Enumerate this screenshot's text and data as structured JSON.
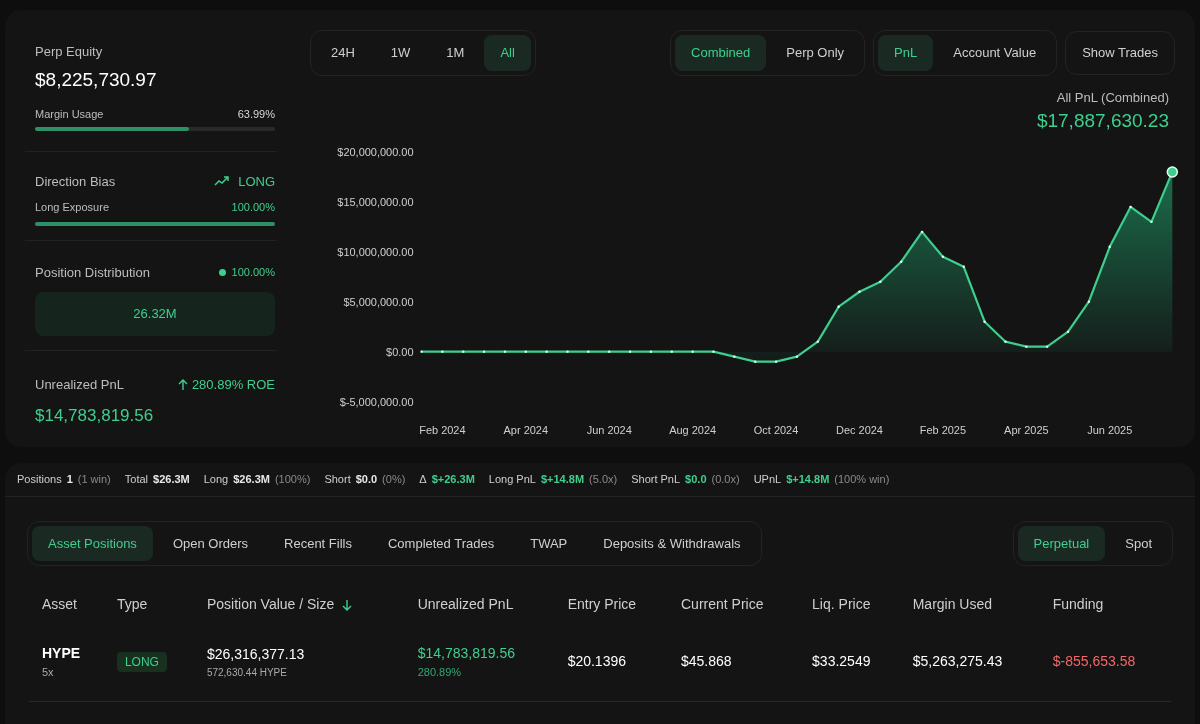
{
  "summary": {
    "equity": {
      "label": "Perp Equity",
      "value": "$8,225,730.97"
    },
    "margin": {
      "label": "Margin Usage",
      "reading": "63.99%",
      "level": 0.6399
    },
    "direction": {
      "label": "Direction Bias",
      "value": "LONG"
    },
    "exposure": {
      "label": "Long Exposure",
      "reading": "100.00%",
      "level": 1
    },
    "distribution": {
      "label": "Position Distribution",
      "reading": "100.00%",
      "color": "#3ecf8e",
      "segments": [
        {
          "value": "26.32M",
          "level": 1
        }
      ]
    },
    "unrealized": {
      "label": "Unrealized PnL",
      "roe": "280.89% ROE",
      "value": "$14,783,819.56"
    }
  },
  "range_tabs": [
    {
      "label": "24H",
      "selected": false
    },
    {
      "label": "1W",
      "selected": false
    },
    {
      "label": "1M",
      "selected": false
    },
    {
      "label": "All",
      "selected": true
    }
  ],
  "scope_tabs": [
    {
      "label": "Combined",
      "selected": true
    },
    {
      "label": "Perp Only",
      "selected": false
    }
  ],
  "metric_tabs": [
    {
      "label": "PnL",
      "selected": true
    },
    {
      "label": "Account Value",
      "selected": false
    }
  ],
  "show_trades": {
    "label": "Show Trades",
    "on": false
  },
  "chart_header": {
    "title": "All PnL (Combined)",
    "value": "$17,887,630.23"
  },
  "chart_data": {
    "type": "area",
    "ylim": [
      -5000000,
      20000000
    ],
    "categories": [
      null,
      "Feb 2024",
      null,
      null,
      null,
      "Apr 2024",
      null,
      null,
      null,
      "Jun 2024",
      null,
      null,
      null,
      "Aug 2024",
      null,
      null,
      null,
      "Oct 2024",
      null,
      null,
      null,
      "Dec 2024",
      null,
      null,
      null,
      "Feb 2025",
      null,
      null,
      null,
      "Apr 2025",
      null,
      null,
      null,
      "Jun 2025",
      null,
      null,
      null
    ],
    "yticks": [
      {
        "value": 20000000,
        "label": "$20,000,000.00"
      },
      {
        "value": 15000000,
        "label": "$15,000,000.00"
      },
      {
        "value": 10000000,
        "label": "$10,000,000.00"
      },
      {
        "value": 5000000,
        "label": "$5,000,000.00"
      },
      {
        "value": 0,
        "label": "$0.00"
      },
      {
        "value": -5000000,
        "label": "$-5,000,000.00"
      }
    ],
    "series": [
      {
        "color": "#3ecf8e",
        "values": [
          0,
          0,
          0,
          0,
          0,
          0,
          0,
          0,
          0,
          0,
          0,
          0,
          0,
          0,
          0,
          -500000,
          -1000000,
          -1000000,
          -500000,
          1000000,
          4500000,
          6000000,
          7000000,
          9000000,
          12000000,
          9500000,
          8500000,
          3000000,
          1000000,
          500000,
          500000,
          2000000,
          5000000,
          10500000,
          14500000,
          13000000,
          18000000
        ]
      }
    ]
  },
  "stats": [
    {
      "label": "Positions",
      "value": "1",
      "note": "(1 win)",
      "color": "#e8e8e8"
    },
    {
      "label": "Total",
      "value": "$26.3M",
      "color": "#e8e8e8"
    },
    {
      "label": "Long",
      "value": "$26.3M",
      "note": "(100%)",
      "color": "#e8e8e8"
    },
    {
      "label": "Short",
      "value": "$0.0",
      "note": "(0%)",
      "color": "#e8e8e8"
    },
    {
      "label": "Δ",
      "value": "$+26.3M",
      "color": "#3ecf8e"
    },
    {
      "label": "Long PnL",
      "value": "$+14.8M",
      "note": "(5.0x)",
      "color": "#3ecf8e"
    },
    {
      "label": "Short PnL",
      "value": "$0.0",
      "note": "(0.0x)",
      "color": "#3ecf8e"
    },
    {
      "label": "UPnL",
      "value": "$+14.8M",
      "note": "(100% win)",
      "color": "#3ecf8e"
    }
  ],
  "section_tabs": [
    {
      "label": "Asset Positions",
      "selected": true
    },
    {
      "label": "Open Orders",
      "selected": false
    },
    {
      "label": "Recent Fills",
      "selected": false
    },
    {
      "label": "Completed Trades",
      "selected": false
    },
    {
      "label": "TWAP",
      "selected": false
    },
    {
      "label": "Deposits & Withdrawals",
      "selected": false
    }
  ],
  "market_tabs": [
    {
      "label": "Perpetual",
      "selected": true
    },
    {
      "label": "Spot",
      "selected": false
    }
  ],
  "table": {
    "columns": [
      {
        "label": "Asset",
        "sorted": false
      },
      {
        "label": "Type",
        "sorted": false
      },
      {
        "label": "Position Value / Size",
        "sorted": true
      },
      {
        "label": "Unrealized PnL",
        "sorted": false
      },
      {
        "label": "Entry Price",
        "sorted": false
      },
      {
        "label": "Current Price",
        "sorted": false
      },
      {
        "label": "Liq. Price",
        "sorted": false
      },
      {
        "label": "Margin Used",
        "sorted": false
      },
      {
        "label": "Funding",
        "sorted": false
      }
    ],
    "rows": [
      {
        "asset": "HYPE",
        "leverage": "5x",
        "type": "LONG",
        "value": "$26,316,377.13",
        "size": "572,630.44 HYPE",
        "upnl": "$14,783,819.56",
        "upnl_pct": "280.89%",
        "entry": "$20.1396",
        "current": "$45.868",
        "liq": "$33.2549",
        "margin": "$5,263,275.43",
        "funding": "$-855,653.58"
      }
    ]
  }
}
